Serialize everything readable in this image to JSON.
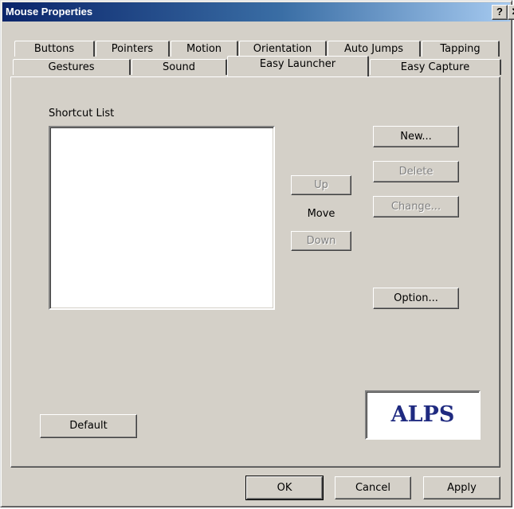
{
  "window": {
    "title": "Mouse Properties",
    "help_glyph": "?",
    "close_glyph": "✕"
  },
  "tabs_row1": [
    "Buttons",
    "Pointers",
    "Motion",
    "Orientation",
    "Auto Jumps",
    "Tapping"
  ],
  "tabs_row2": [
    "Gestures",
    "Sound",
    "Easy Launcher",
    "Easy Capture"
  ],
  "active_tab": "Easy Launcher",
  "panel": {
    "shortcut_list_label": "Shortcut List",
    "up_button": "Up",
    "move_label": "Move",
    "down_button": "Down",
    "new_button": "New...",
    "delete_button": "Delete",
    "change_button": "Change...",
    "option_button": "Option...",
    "default_button": "Default",
    "logo_text": "ALPS"
  },
  "footer": {
    "ok": "OK",
    "cancel": "Cancel",
    "apply": "Apply"
  },
  "colors": {
    "face": "#d4d0c8",
    "title_start": "#0a246a",
    "title_end": "#a6caf0",
    "logo": "#1f2a80"
  }
}
